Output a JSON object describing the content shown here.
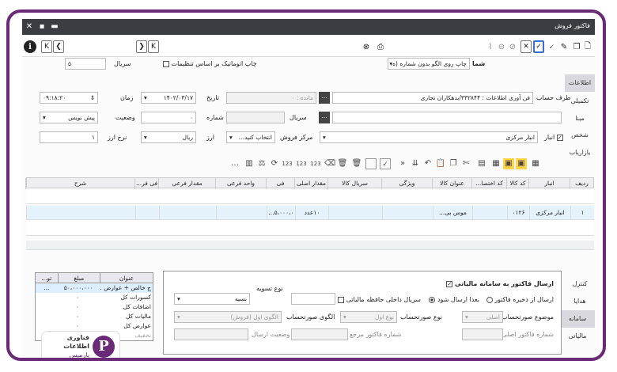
{
  "window": {
    "title": "فاکتور فروش"
  },
  "toolbar": {
    "print_template": "چاپ روی الگو بدون شماره (ه",
    "number_label": "شما",
    "auto_print_label": "چاپ اتوماتیک بر اساس تنظیمات",
    "serial_label": "سریال",
    "serial_value": "۵"
  },
  "header_tabs": [
    "اطلاعات",
    "تکمیلی",
    "مبنا",
    "شخص",
    "بازاریاب"
  ],
  "form": {
    "party_label": "طرف حساب",
    "party_value": "فن آوری اطلاعات : ۳۳۲۸۴۴/بدهکاران تجاری",
    "remain_label": "مانده :",
    "remain_value": "۰",
    "date_label": "تاریخ",
    "date_value": "۱۴۰۲/۰۳/۱۷",
    "time_label": "زمان",
    "time_value": "۰۹:۱۸:۲۰",
    "serial_label": "سریال",
    "number_label": "شماره",
    "number_value": "۰",
    "status_label": "وضعیت",
    "status_value": "۰",
    "draft_value": "پیش نویس",
    "warehouse_label": "انبار",
    "warehouse_value": "انبار مرکزی",
    "sales_center_label": "مرکز فروش",
    "sales_center_placeholder": "انتخاب کنید...",
    "currency_label": "ارز",
    "currency_value": "ریال",
    "rate_label": "نرخ ارز",
    "rate_value": "۱"
  },
  "grid": {
    "columns": [
      "ردیف",
      "انبار",
      "کد کالا",
      "کد اختصا...",
      "عنوان کالا",
      "ویژگی",
      "سریال کالا",
      "مقدار اصلی",
      "فی",
      "واحد فرعی",
      "مقدار فرعی",
      "فی فر...",
      "شرح"
    ],
    "row": {
      "index": "۱",
      "warehouse": "انبار مرکزی",
      "code": "۰۱۲۶",
      "title": "موس بی...",
      "qty": "۱۰عدد",
      "price": "۵،۰۰۰،۰..."
    }
  },
  "summary": {
    "col_title": "عنوان",
    "col_amount": "مبلغ",
    "col_extra": "تو...",
    "rows": [
      {
        "title": "ج خالص + عوارض ...",
        "amount": "۵۰،۰۰۰،۰۰۰",
        "extra": "..."
      },
      {
        "title": "کسورات کل",
        "amount": "۰",
        "extra": ""
      },
      {
        "title": "اضافات کل",
        "amount": "۰",
        "extra": ""
      },
      {
        "title": "مالیات کل",
        "amount": "۰",
        "extra": ""
      },
      {
        "title": "عوارض کل",
        "amount": "۰",
        "extra": ""
      },
      {
        "title": "تخفیف",
        "amount": "",
        "extra": ""
      }
    ]
  },
  "bottom_tabs": [
    "کنترل",
    "هدایا",
    "سامانه مالیاتی"
  ],
  "tax": {
    "send_label": "ارسال فاکتور به سامانه مالیاتی",
    "send_after_save": "ارسال از ذخیره فاکتور",
    "send_later": "بعدا ارسال شود",
    "internal_serial": "سریال داخلی حافظه مالیاتی",
    "settle_type_label": "نوع تسویه",
    "settle_type_value": "نسیه",
    "invoice_subject_label": "موضوع صورتحساب",
    "invoice_subject_value": "اصلی",
    "invoice_type_label": "نوع صورتحساب",
    "invoice_type_value": "نوع اول",
    "invoice_pattern_label": "الگوی صورتحساب",
    "invoice_pattern_value": "الگوی اول (فروش)",
    "ref_invoice_number": "شماره فاکتور مرجع",
    "main_invoice_number": "شماره فاکتور اصلی",
    "send_status": "وضعیت ارسال"
  },
  "logo": {
    "line1": "فناوری",
    "line2": "اطلاعات",
    "line3": "پارمیس"
  }
}
